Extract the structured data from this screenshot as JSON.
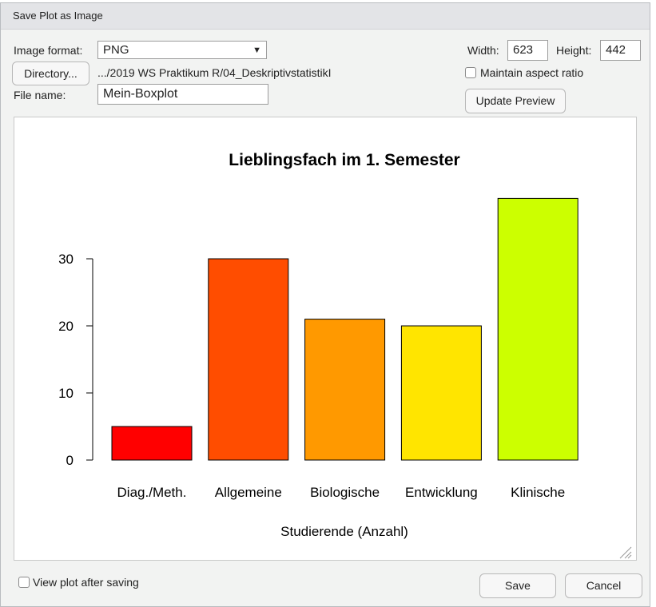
{
  "dialog": {
    "title": "Save Plot as Image"
  },
  "form": {
    "format_label": "Image format:",
    "format_value": "PNG",
    "directory_button": "Directory...",
    "directory_path": ".../2019 WS Praktikum R/04_DeskriptivstatistikI",
    "filename_label": "File name:",
    "filename_value": "Mein-Boxplot",
    "width_label": "Width:",
    "width_value": "623",
    "height_label": "Height:",
    "height_value": "442",
    "aspect_label": "Maintain aspect ratio",
    "aspect_checked": false,
    "update_button": "Update Preview",
    "view_after_label": "View plot after saving",
    "view_after_checked": false,
    "save_button": "Save",
    "cancel_button": "Cancel"
  },
  "chart_data": {
    "type": "bar",
    "title": "Lieblingsfach im 1. Semester",
    "xlabel": "Studierende (Anzahl)",
    "ylabel": "",
    "categories": [
      "Diag./Meth.",
      "Allgemeine",
      "Biologische",
      "Entwicklung",
      "Klinische"
    ],
    "values": [
      5,
      30,
      21,
      20,
      39
    ],
    "colors": [
      "#ff0000",
      "#ff4d00",
      "#ff9900",
      "#ffe500",
      "#ccff00"
    ],
    "yticks": [
      0,
      10,
      20,
      30
    ],
    "ylim": [
      0,
      39
    ]
  }
}
